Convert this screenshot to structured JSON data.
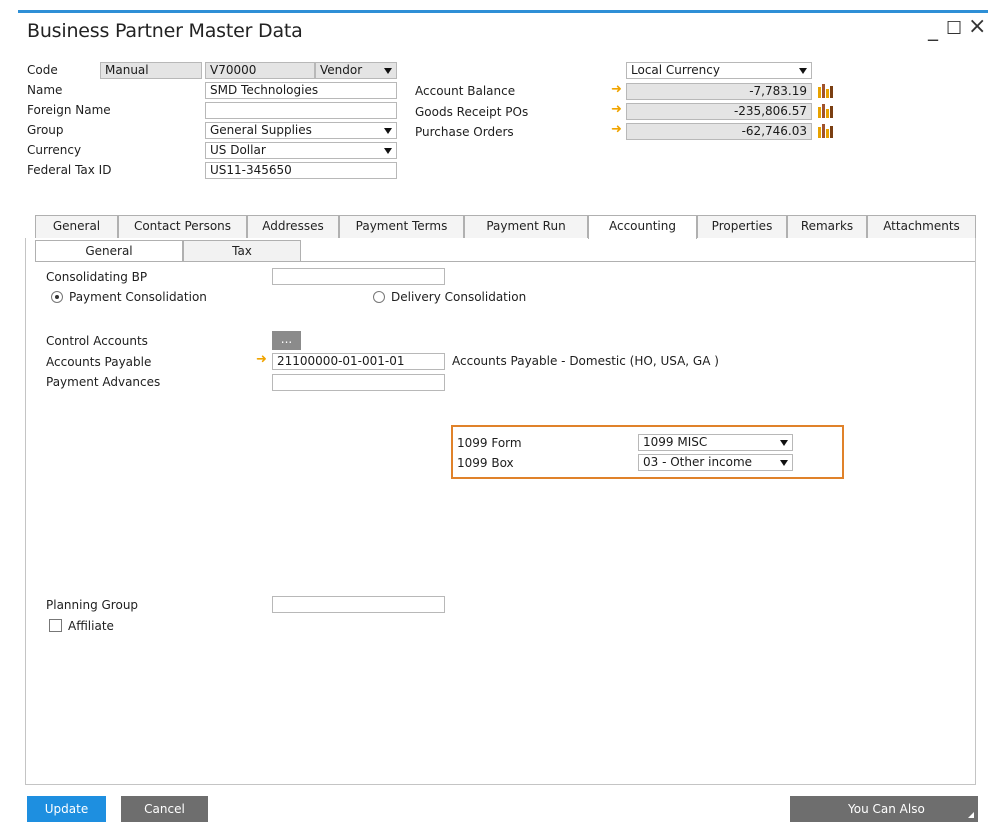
{
  "window": {
    "title": "Business Partner Master Data",
    "minimize_glyph": "_",
    "maximize_glyph": "☐",
    "close_glyph": "×"
  },
  "header": {
    "code_label": "Code",
    "code_series": "Manual",
    "code_value": "V70000",
    "type_value": "Vendor",
    "name_label": "Name",
    "name_value": "SMD Technologies",
    "foreign_name_label": "Foreign Name",
    "foreign_name_value": "",
    "group_label": "Group",
    "group_value": "General Supplies",
    "currency_label": "Currency",
    "currency_value": "US Dollar",
    "tax_id_label": "Federal Tax ID",
    "tax_id_value": "US11-345650",
    "currency_view": "Local Currency",
    "account_balance_label": "Account Balance",
    "account_balance_value": "-7,783.19",
    "goods_receipt_label": "Goods Receipt POs",
    "goods_receipt_value": "-235,806.57",
    "purchase_orders_label": "Purchase Orders",
    "purchase_orders_value": "-62,746.03"
  },
  "tabs": [
    {
      "label": "General"
    },
    {
      "label": "Contact Persons"
    },
    {
      "label": "Addresses"
    },
    {
      "label": "Payment Terms"
    },
    {
      "label": "Payment Run"
    },
    {
      "label": "Accounting"
    },
    {
      "label": "Properties"
    },
    {
      "label": "Remarks"
    },
    {
      "label": "Attachments"
    }
  ],
  "subtabs": [
    {
      "label": "General"
    },
    {
      "label": "Tax"
    }
  ],
  "accounting": {
    "consolidating_bp_label": "Consolidating BP",
    "consolidating_bp_value": "",
    "payment_consolidation_label": "Payment Consolidation",
    "delivery_consolidation_label": "Delivery Consolidation",
    "control_accounts_label": "Control Accounts",
    "control_accounts_button": "...",
    "accounts_payable_label": "Accounts Payable",
    "accounts_payable_value": "21100000-01-001-01",
    "accounts_payable_desc": "Accounts Payable - Domestic (HO, USA, GA )",
    "payment_advances_label": "Payment Advances",
    "payment_advances_value": "",
    "form1099_label": "1099 Form",
    "form1099_value": "1099 MISC",
    "box1099_label": "1099 Box",
    "box1099_value": "03  - Other income",
    "planning_group_label": "Planning Group",
    "planning_group_value": "",
    "affiliate_label": "Affiliate"
  },
  "footer": {
    "update_label": "Update",
    "cancel_label": "Cancel",
    "you_can_also_label": "You Can Also"
  },
  "colors": {
    "accent_blue": "#1e8fe0",
    "highlight_orange": "#e0822a",
    "link_arrow": "#f0a400",
    "button_gray": "#6e6e6e"
  }
}
